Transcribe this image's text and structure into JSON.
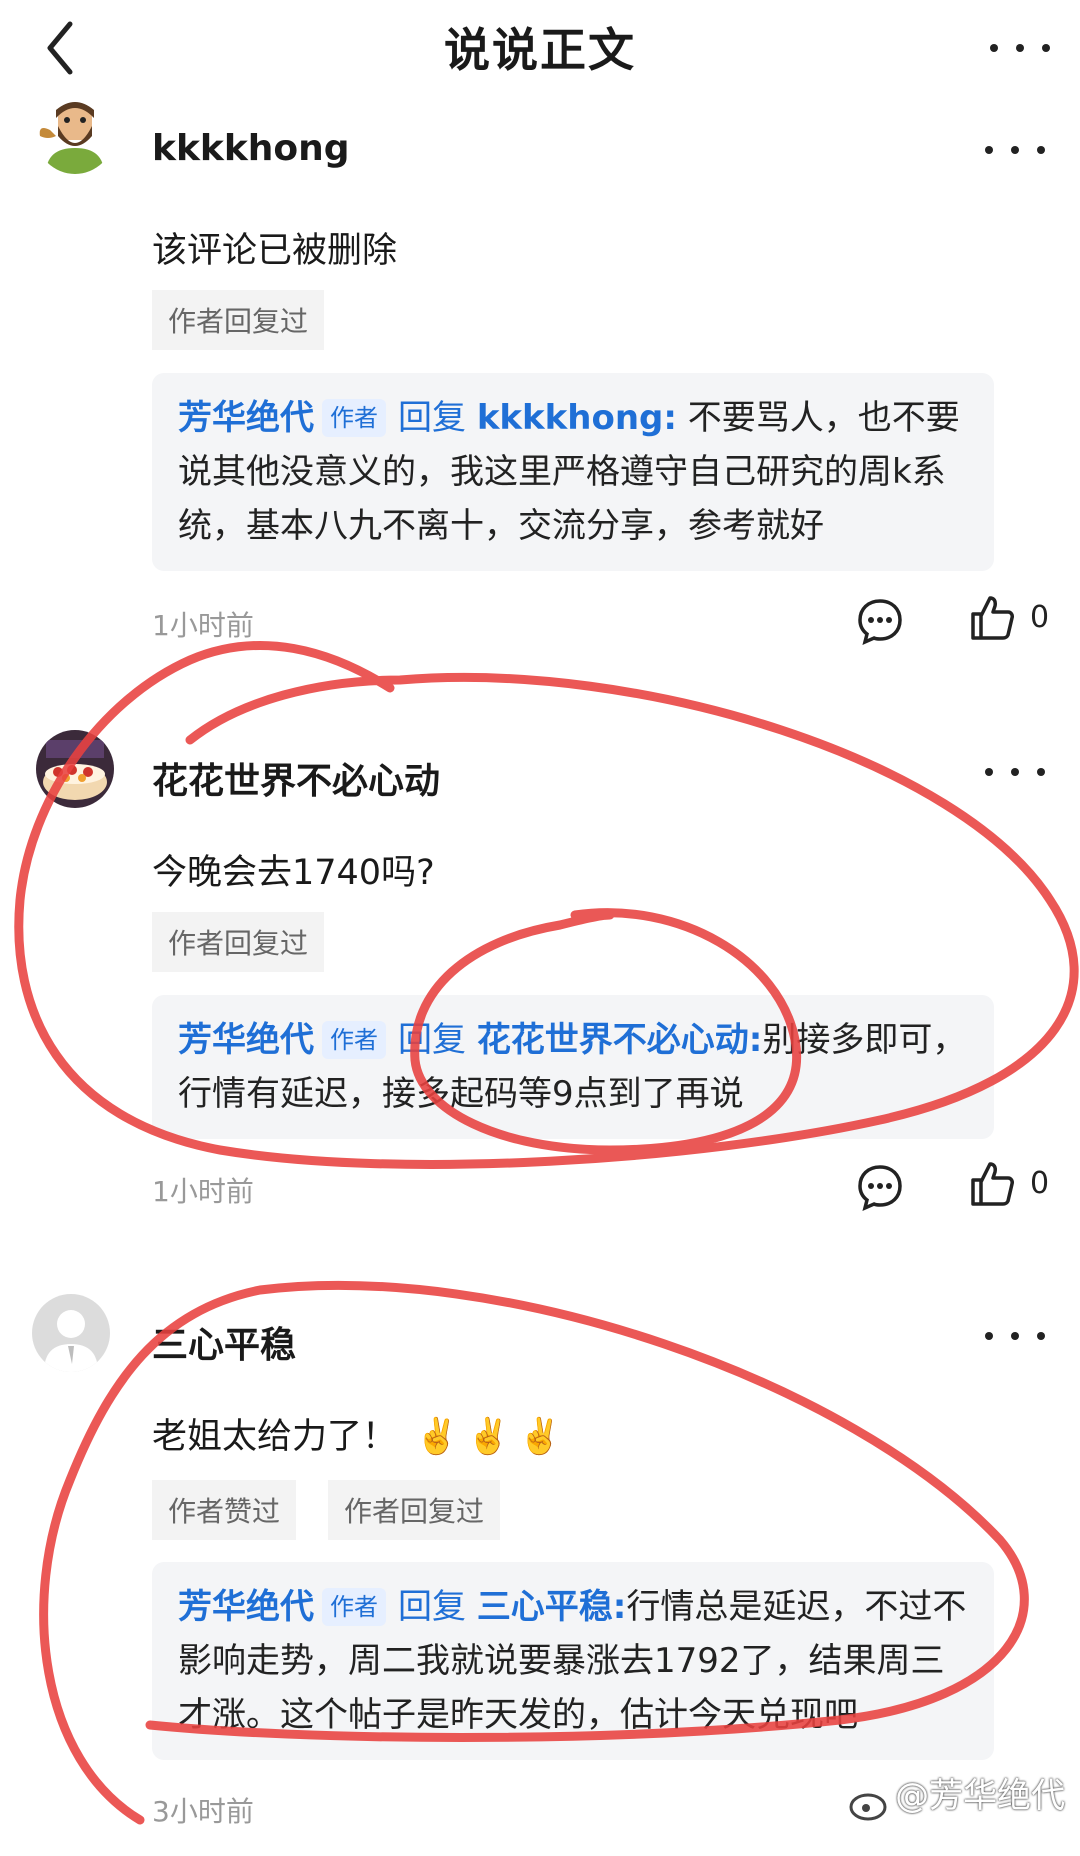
{
  "header": {
    "title": "说说正文"
  },
  "comments": [
    {
      "username": "kkkkhong",
      "text": "该评论已被删除",
      "tags": [
        "作者回复过"
      ],
      "reply": {
        "author": "芳华绝代",
        "badge": "作者",
        "action": "回复",
        "target": "kkkkhong:",
        "text": "不要骂人，也不要说其他没意义的，我这里严格遵守自己研究的周k系统，基本八九不离十，交流分享，参考就好"
      },
      "time": "1小时前",
      "likes": "0"
    },
    {
      "username": "花花世界不必心动",
      "text": "今晚会去1740吗?",
      "tags": [
        "作者回复过"
      ],
      "reply": {
        "author": "芳华绝代",
        "badge": "作者",
        "action": "回复",
        "target": "花花世界不必心动:",
        "text": "别接多即可，行情有延迟，接多起码等9点到了再说"
      },
      "time": "1小时前",
      "likes": "0"
    },
    {
      "username": "三心平稳",
      "text": "老姐太给力了！",
      "emoji": "✌️✌️✌️",
      "tags": [
        "作者赞过",
        "作者回复过"
      ],
      "reply": {
        "author": "芳华绝代",
        "badge": "作者",
        "action": "回复",
        "target": "三心平稳:",
        "text": "行情总是延迟，不过不影响走势，周二我就说要暴涨去1792了，结果周三才涨。这个帖子是昨天发的，估计今天兑现吧"
      },
      "time": "3小时前"
    }
  ],
  "watermark": "@芳华绝代",
  "colors": {
    "link_blue": "#1f6fd6",
    "ink_red": "#e8413f",
    "tag_bg": "#f3f3f3",
    "reply_bg": "#f4f5f7"
  }
}
